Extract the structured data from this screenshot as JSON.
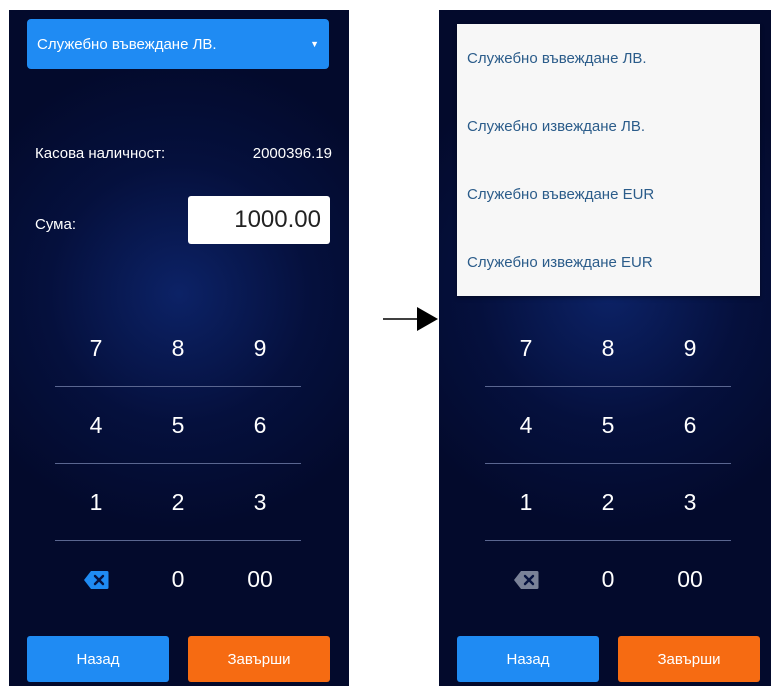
{
  "left_screen": {
    "dropdown": {
      "selected": "Служебно въвеждане ЛВ."
    },
    "balance": {
      "label": "Касова наличност:",
      "value": "2000396.19"
    },
    "amount": {
      "label": "Сума:",
      "value": "1000.00"
    },
    "keypad": {
      "rows": [
        [
          "7",
          "8",
          "9"
        ],
        [
          "4",
          "5",
          "6"
        ],
        [
          "1",
          "2",
          "3"
        ],
        [
          "",
          "0",
          "00"
        ]
      ],
      "backspace_icon": "backspace-icon"
    },
    "buttons": {
      "back": "Назад",
      "finish": "Завърши"
    }
  },
  "right_screen": {
    "menu_items": [
      "Служебно въвеждане ЛВ.",
      "Служебно извеждане ЛВ.",
      "Служебно въвеждане EUR",
      "Служебно извеждане EUR"
    ],
    "keypad": {
      "rows": [
        [
          "7",
          "8",
          "9"
        ],
        [
          "4",
          "5",
          "6"
        ],
        [
          "1",
          "2",
          "3"
        ],
        [
          "",
          "0",
          "00"
        ]
      ],
      "backspace_icon": "backspace-icon"
    },
    "buttons": {
      "back": "Назад",
      "finish": "Завърши"
    }
  },
  "colors": {
    "primary_blue": "#1f8bf3",
    "accent_orange": "#f66b12",
    "background_navy": "#05103d",
    "menu_text": "#2b5c8a"
  },
  "transition_icon": "right-arrow-icon"
}
